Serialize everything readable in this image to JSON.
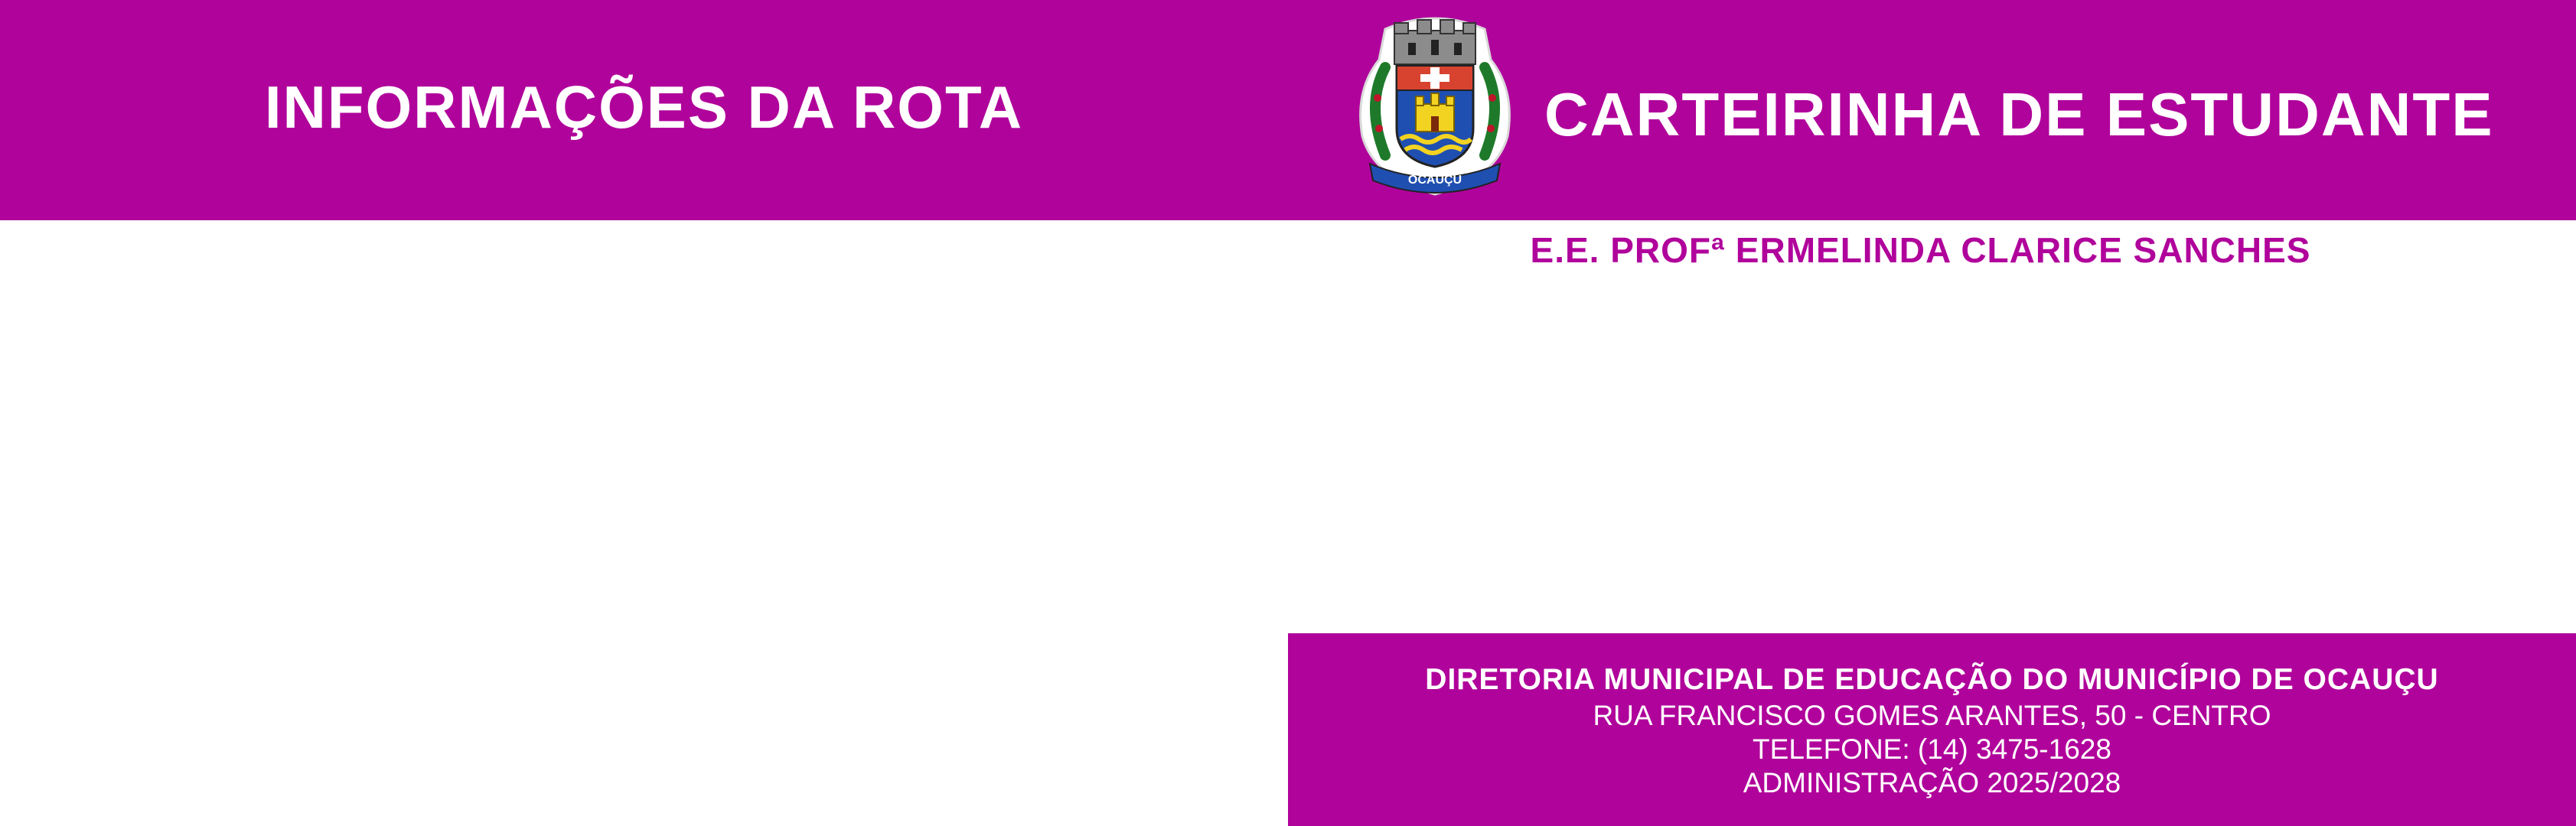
{
  "colors": {
    "primary": "#b0039b",
    "text_on_primary": "#ffffff"
  },
  "back_side": {
    "title": "INFORMAÇÕES DA ROTA"
  },
  "front_side": {
    "title": "CARTEIRINHA DE ESTUDANTE",
    "crest_icon": "municipal-coat-of-arms",
    "crest_text": "OCAUÇU",
    "school_name": "E.E. PROFª ERMELINDA CLARICE SANCHES",
    "footer": {
      "department": "DIRETORIA MUNICIPAL DE EDUCAÇÃO DO MUNICÍPIO DE OCAUÇU",
      "address": "RUA FRANCISCO GOMES ARANTES, 50 - CENTRO",
      "phone": "TELEFONE: (14) 3475-1628",
      "administration": "ADMINISTRAÇÃO 2025/2028"
    }
  }
}
